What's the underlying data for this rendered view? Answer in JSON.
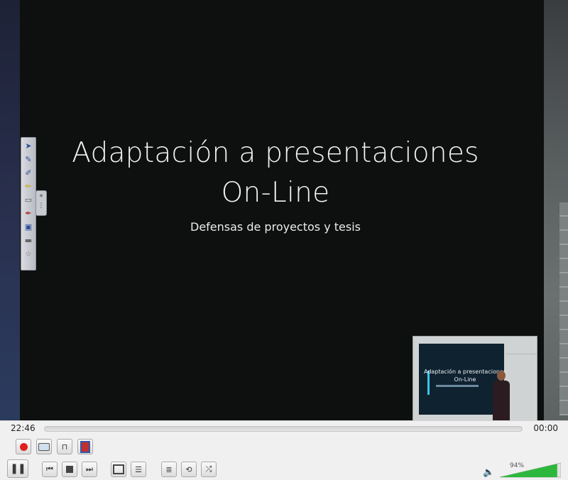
{
  "slide": {
    "title_line1": "Adaptación a presentaciones",
    "title_line2": "On-Line",
    "subtitle": "Defensas de proyectos y tesis"
  },
  "pip": {
    "title_line1": "Adaptación a presentaciones",
    "title_line2": "On-Line"
  },
  "player": {
    "time_elapsed": "22:46",
    "time_remaining": "00:00",
    "volume_percent": "94%",
    "volume_level": 0.94,
    "progress": 0.0
  },
  "buttons": {
    "row1": [
      "record-icon",
      "snapshot-icon",
      "loop-ab-icon",
      "frame-step-icon"
    ],
    "row2": [
      "pause-icon",
      "previous-icon",
      "stop-icon",
      "next-icon",
      "fullscreen-icon",
      "extended-settings-icon",
      "playlist-icon",
      "loop-icon",
      "shuffle-icon"
    ]
  },
  "colors": {
    "record": "#e02020",
    "volume_fill": "#2db83d"
  }
}
